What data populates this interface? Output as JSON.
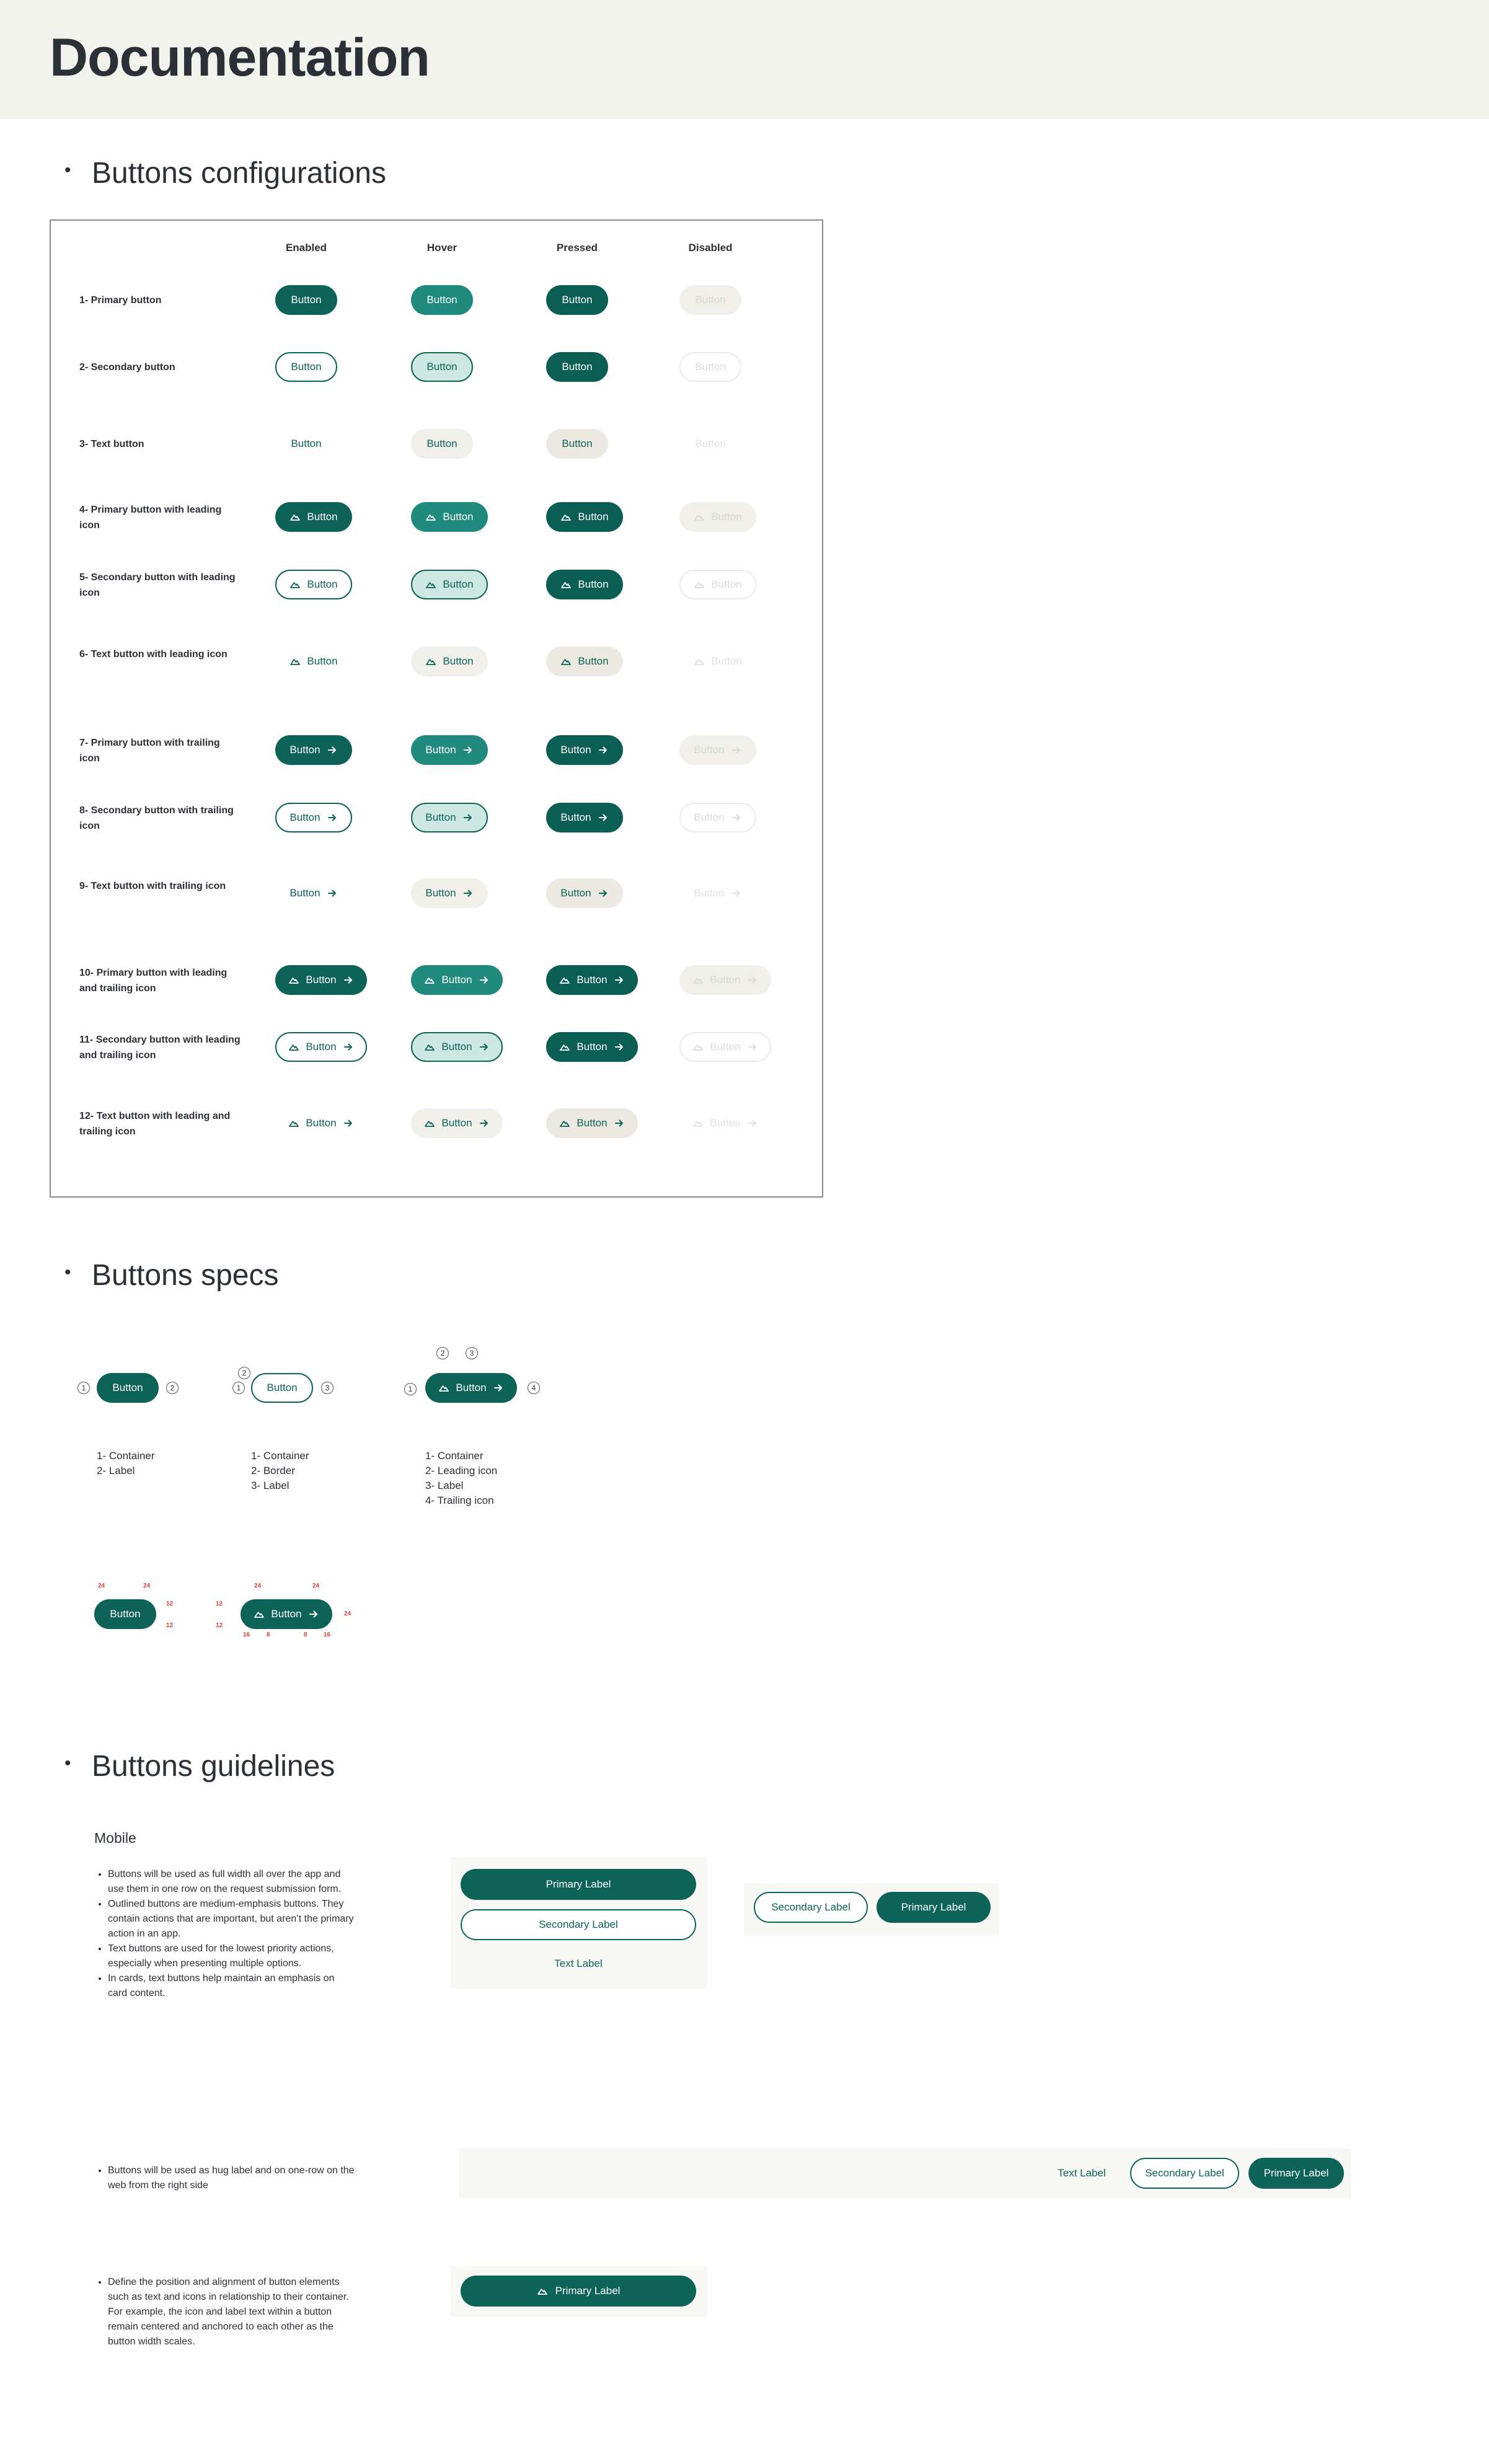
{
  "page": {
    "title": "Documentation"
  },
  "sections": {
    "configurations": "Buttons configurations",
    "specs": "Buttons specs",
    "guidelines": "Buttons guidelines"
  },
  "config": {
    "columns": [
      "Enabled",
      "Hover",
      "Pressed",
      "Disabled"
    ],
    "button_label": "Button",
    "rows": [
      {
        "label": "1- Primary button",
        "variant": "primary",
        "lead": false,
        "trail": false
      },
      {
        "label": "2- Secondary button",
        "variant": "secondary",
        "lead": false,
        "trail": false
      },
      {
        "label": "3- Text button",
        "variant": "text",
        "lead": false,
        "trail": false
      },
      {
        "label": "4- Primary button with leading icon",
        "variant": "primary",
        "lead": true,
        "trail": false
      },
      {
        "label": "5- Secondary button with leading icon",
        "variant": "secondary",
        "lead": true,
        "trail": false
      },
      {
        "label": "6- Text button with leading icon",
        "variant": "text",
        "lead": true,
        "trail": false
      },
      {
        "label": "7- Primary button with trailing icon",
        "variant": "primary",
        "lead": false,
        "trail": true
      },
      {
        "label": "8- Secondary button with trailing icon",
        "variant": "secondary",
        "lead": false,
        "trail": true
      },
      {
        "label": "9- Text button with trailing icon",
        "variant": "text",
        "lead": false,
        "trail": true
      },
      {
        "label": "10- Primary button with leading and trailing icon",
        "variant": "primary",
        "lead": true,
        "trail": true
      },
      {
        "label": "11- Secondary button with leading and trailing icon",
        "variant": "secondary",
        "lead": true,
        "trail": true
      },
      {
        "label": "12- Text button with leading and trailing icon",
        "variant": "text",
        "lead": true,
        "trail": true
      }
    ]
  },
  "specs": {
    "button_label": "Button",
    "anatomy": [
      {
        "items": [
          "1- Container",
          "2- Label"
        ]
      },
      {
        "items": [
          "1- Container",
          "2- Border",
          "3- Label"
        ]
      },
      {
        "items": [
          "1- Container",
          "2- Leading icon",
          "3- Label",
          "4- Trailing icon"
        ]
      }
    ],
    "measurements": [
      "24",
      "24",
      "12",
      "12",
      "12",
      "12",
      "24",
      "24",
      "24",
      "16",
      "8",
      "8",
      "16"
    ]
  },
  "guidelines": {
    "mobile_label": "Mobile",
    "block1": [
      "Buttons will be used as full width all over the app and use them in one row on the request submission form.",
      "Outlined buttons are medium-emphasis buttons. They contain actions that are important, but aren’t the primary action in an app.",
      "Text buttons are used for the lowest priority actions, especially when presenting multiple options.",
      "In cards, text buttons help maintain an emphasis on card content."
    ],
    "block2": [
      "Buttons will be used as hug label and on one-row on the web from the right side"
    ],
    "block3": [
      "Define the position and alignment of button elements such as text and icons in relationship to their container. For example, the icon and label text within a button remain centered and anchored to each other as the button width scales."
    ],
    "primary_label": "Primary Label",
    "secondary_label": "Secondary Label",
    "text_label": "Text Label"
  },
  "colors": {
    "brand": "#0d6358",
    "hover": "#1f8a7d",
    "hover_tint": "#cde8e2",
    "neutral_bg": "#f0efea",
    "measure": "#e0413a"
  },
  "icons": [
    "mountain-icon",
    "arrow-right-icon"
  ]
}
